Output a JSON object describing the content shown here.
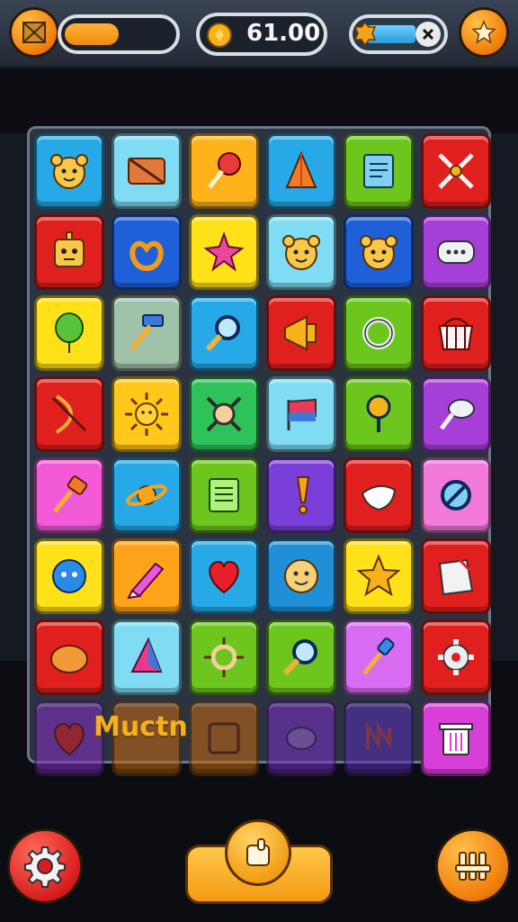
{
  "hud": {
    "coins_value": "61.00",
    "energy_level": 0.45,
    "progress_level": 0.6
  },
  "board": {
    "rows": [
      [
        {
          "color": "#27a9e8",
          "icon": "bear-face-icon"
        },
        {
          "color": "#7fdcf2",
          "icon": "envelope-icon"
        },
        {
          "color": "#ffb31a",
          "icon": "lollipop-icon"
        },
        {
          "color": "#27a9e8",
          "icon": "cone-icon"
        },
        {
          "color": "#6cc61e",
          "icon": "notepad-icon"
        },
        {
          "color": "#e01f1f",
          "icon": "crossed-swords-icon"
        }
      ],
      [
        {
          "color": "#e01f1f",
          "icon": "robot-face-icon"
        },
        {
          "color": "#1f5fd8",
          "icon": "pretzel-icon"
        },
        {
          "color": "#ffe11a",
          "icon": "starfish-icon"
        },
        {
          "color": "#7fdcf2",
          "icon": "bear-face-icon"
        },
        {
          "color": "#1f5fd8",
          "icon": "bear-face-icon"
        },
        {
          "color": "#a63fd8",
          "icon": "chat-bubble-icon"
        }
      ],
      [
        {
          "color": "#ffe11a",
          "icon": "balloon-icon"
        },
        {
          "color": "#9fc2a8",
          "icon": "hammer-icon"
        },
        {
          "color": "#27a9e8",
          "icon": "magnifier-icon"
        },
        {
          "color": "#e01f1f",
          "icon": "megaphone-icon"
        },
        {
          "color": "#6cc61e",
          "icon": "ring-icon"
        },
        {
          "color": "#e01f1f",
          "icon": "basket-icon"
        }
      ],
      [
        {
          "color": "#e01f1f",
          "icon": "bow-icon"
        },
        {
          "color": "#ffc81a",
          "icon": "sun-icon"
        },
        {
          "color": "#2ec25a",
          "icon": "gear-cross-icon"
        },
        {
          "color": "#7fdcf2",
          "icon": "flag-icon"
        },
        {
          "color": "#6cc61e",
          "icon": "key-ring-icon"
        },
        {
          "color": "#a63fd8",
          "icon": "cloud-key-icon"
        }
      ],
      [
        {
          "color": "#f25ad8",
          "icon": "mallet-icon"
        },
        {
          "color": "#27a9e8",
          "icon": "saturn-icon"
        },
        {
          "color": "#6cc61e",
          "icon": "notebook-icon"
        },
        {
          "color": "#7a3fd8",
          "icon": "exclamation-icon"
        },
        {
          "color": "#e01f1f",
          "icon": "splash-icon"
        },
        {
          "color": "#f27ad8",
          "icon": "no-sign-icon"
        }
      ],
      [
        {
          "color": "#ffe11a",
          "icon": "blue-face-icon"
        },
        {
          "color": "#ffa31a",
          "icon": "crayon-icon"
        },
        {
          "color": "#27a9e8",
          "icon": "heart-icon"
        },
        {
          "color": "#1f8fd8",
          "icon": "smiley-icon"
        },
        {
          "color": "#ffe11a",
          "icon": "star-icon"
        },
        {
          "color": "#e01f1f",
          "icon": "torn-paper-icon"
        }
      ],
      [
        {
          "color": "#e01f1f",
          "icon": "blob-icon"
        },
        {
          "color": "#7fdcf2",
          "icon": "pennant-icon"
        },
        {
          "color": "#6cc61e",
          "icon": "spiky-ring-icon"
        },
        {
          "color": "#6cc61e",
          "icon": "magnifier-icon"
        },
        {
          "color": "#d86cf2",
          "icon": "paintbrush-icon"
        },
        {
          "color": "#e01f1f",
          "icon": "gear-icon"
        }
      ],
      [
        {
          "color": "#8a2fc8",
          "icon": "heart-icon"
        },
        {
          "color": "#c86a10",
          "icon": "blank"
        },
        {
          "color": "#c86a10",
          "icon": "frame-icon"
        },
        {
          "color": "#7a2fc8",
          "icon": "speech-icon"
        },
        {
          "color": "#5a2fb8",
          "icon": "zigzag-icon"
        },
        {
          "color": "#d83fd8",
          "icon": "trash-icon"
        }
      ]
    ],
    "bottom_label": "Muctn"
  }
}
